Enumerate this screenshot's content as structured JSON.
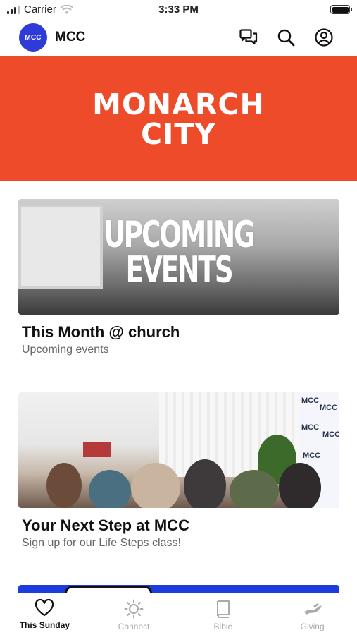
{
  "status_bar": {
    "carrier": "Carrier",
    "time": "3:33 PM"
  },
  "header": {
    "logo_text": "MCC",
    "app_name": "MCC",
    "icons": [
      "chat-icon",
      "search-icon",
      "account-icon"
    ]
  },
  "banner": {
    "line1": "MONARCH",
    "line2": "CITY",
    "background": "#ee4b2b"
  },
  "cards": [
    {
      "image_line1": "UPCOMING",
      "image_line2": "EVENTS",
      "title": "This Month @ church",
      "subtitle": "Upcoming events"
    },
    {
      "backdrop_text": "MCC",
      "title": "Your Next Step at MCC",
      "subtitle": "Sign up for our Life Steps class!"
    }
  ],
  "tabs": [
    {
      "label": "This Sunday",
      "icon": "heart-icon",
      "active": true
    },
    {
      "label": "Connect",
      "icon": "sun-icon",
      "active": false
    },
    {
      "label": "Bible",
      "icon": "book-icon",
      "active": false
    },
    {
      "label": "Giving",
      "icon": "giving-hand-icon",
      "active": false
    }
  ],
  "colors": {
    "brand": "#2f3bd8",
    "banner": "#ee4b2b",
    "peek_card": "#1c3cdb"
  }
}
